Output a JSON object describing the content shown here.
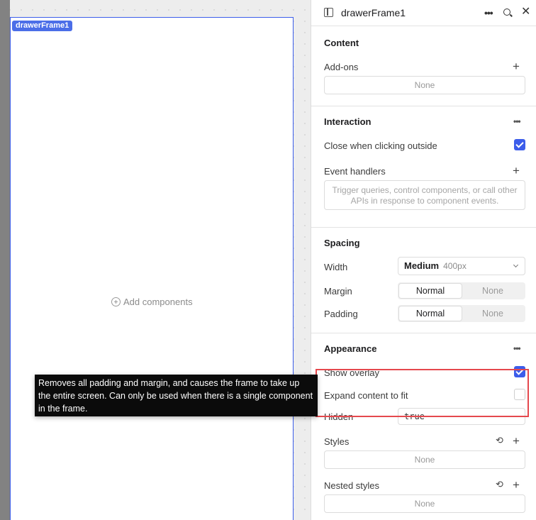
{
  "canvas": {
    "frame_tag": "drawerFrame1",
    "add_components": "Add components"
  },
  "inspector": {
    "title": "drawerFrame1",
    "icons": [
      "panel-icon",
      "more-icon",
      "search-icon",
      "close-icon"
    ],
    "content": {
      "title": "Content",
      "addons_label": "Add-ons",
      "addons_value": "None"
    },
    "interaction": {
      "title": "Interaction",
      "close_outside_label": "Close when clicking outside",
      "close_outside_checked": true,
      "event_handlers_label": "Event handlers",
      "event_handlers_placeholder": "Trigger queries, control components, or call other APIs in response to component events."
    },
    "spacing": {
      "title": "Spacing",
      "width_label": "Width",
      "width_value": "Medium",
      "width_hint": "400px",
      "margin_label": "Margin",
      "margin_options": [
        "Normal",
        "None"
      ],
      "margin_selected": "Normal",
      "padding_label": "Padding",
      "padding_options": [
        "Normal",
        "None"
      ],
      "padding_selected": "Normal"
    },
    "appearance": {
      "title": "Appearance",
      "show_overlay_label": "Show overlay",
      "show_overlay_checked": true,
      "expand_label": "Expand content to fit",
      "expand_checked": false,
      "hidden_label": "Hidden",
      "hidden_value": "true",
      "styles_label": "Styles",
      "styles_value": "None",
      "nested_styles_label": "Nested styles",
      "nested_styles_value": "None"
    }
  },
  "tooltip": {
    "text": "Removes all padding and margin, and causes the frame to take up the entire screen. Can only be used when there is a single component in the frame."
  },
  "colors": {
    "accent": "#3c5dea",
    "highlight": "#e5484d",
    "tooltip_bg": "#0b0b0b"
  }
}
